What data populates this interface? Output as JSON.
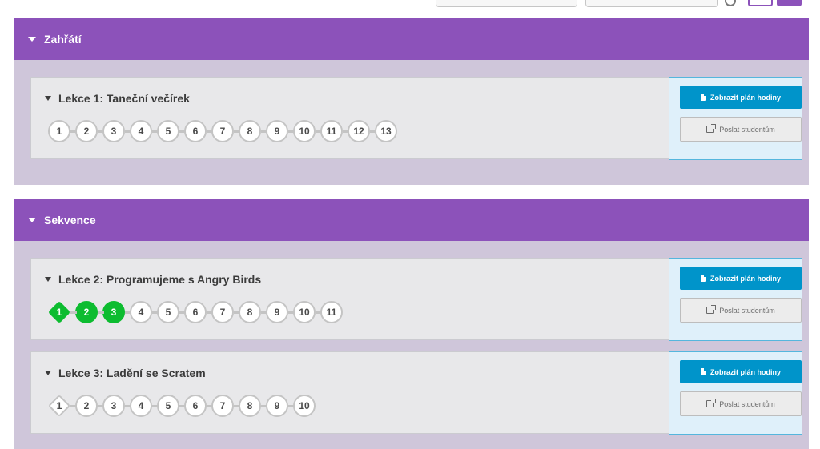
{
  "units": [
    {
      "title": "Zahřátí",
      "lessons": [
        {
          "title": "Lekce 1: Taneční večírek",
          "bubbles": [
            {
              "label": "1",
              "shape": "circle",
              "done": false
            },
            {
              "label": "2",
              "shape": "circle",
              "done": false
            },
            {
              "label": "3",
              "shape": "circle",
              "done": false
            },
            {
              "label": "4",
              "shape": "circle",
              "done": false
            },
            {
              "label": "5",
              "shape": "circle",
              "done": false
            },
            {
              "label": "6",
              "shape": "circle",
              "done": false
            },
            {
              "label": "7",
              "shape": "circle",
              "done": false
            },
            {
              "label": "8",
              "shape": "circle",
              "done": false
            },
            {
              "label": "9",
              "shape": "circle",
              "done": false
            },
            {
              "label": "10",
              "shape": "circle",
              "done": false
            },
            {
              "label": "11",
              "shape": "circle",
              "done": false
            },
            {
              "label": "12",
              "shape": "circle",
              "done": false
            },
            {
              "label": "13",
              "shape": "circle",
              "done": false
            }
          ],
          "plan_label": "Zobrazit plán hodiny",
          "send_label": "Poslat studentům"
        }
      ]
    },
    {
      "title": "Sekvence",
      "lessons": [
        {
          "title": "Lekce 2: Programujeme s Angry Birds",
          "bubbles": [
            {
              "label": "1",
              "shape": "diamond",
              "done": true
            },
            {
              "label": "2",
              "shape": "circle",
              "done": true
            },
            {
              "label": "3",
              "shape": "circle",
              "done": true
            },
            {
              "label": "4",
              "shape": "circle",
              "done": false
            },
            {
              "label": "5",
              "shape": "circle",
              "done": false
            },
            {
              "label": "6",
              "shape": "circle",
              "done": false
            },
            {
              "label": "7",
              "shape": "circle",
              "done": false
            },
            {
              "label": "8",
              "shape": "circle",
              "done": false
            },
            {
              "label": "9",
              "shape": "circle",
              "done": false
            },
            {
              "label": "10",
              "shape": "circle",
              "done": false
            },
            {
              "label": "11",
              "shape": "circle",
              "done": false
            }
          ],
          "plan_label": "Zobrazit plán hodiny",
          "send_label": "Poslat studentům"
        },
        {
          "title": "Lekce 3: Ladění se Scratem",
          "bubbles": [
            {
              "label": "1",
              "shape": "diamond",
              "done": false
            },
            {
              "label": "2",
              "shape": "circle",
              "done": false
            },
            {
              "label": "3",
              "shape": "circle",
              "done": false
            },
            {
              "label": "4",
              "shape": "circle",
              "done": false
            },
            {
              "label": "5",
              "shape": "circle",
              "done": false
            },
            {
              "label": "6",
              "shape": "circle",
              "done": false
            },
            {
              "label": "7",
              "shape": "circle",
              "done": false
            },
            {
              "label": "8",
              "shape": "circle",
              "done": false
            },
            {
              "label": "9",
              "shape": "circle",
              "done": false
            },
            {
              "label": "10",
              "shape": "circle",
              "done": false
            }
          ],
          "plan_label": "Zobrazit plán hodiny",
          "send_label": "Poslat studentům"
        }
      ]
    }
  ],
  "colors": {
    "unit_header": "#8c52ba",
    "unit_body": "#cfc6da",
    "primary_button": "#0094ca",
    "progress_done": "#0dbc30",
    "action_panel_border": "#55b6dd"
  },
  "icons": {
    "unit_toggle": "caret-down-icon",
    "plan_button": "document-icon",
    "send_button": "share-icon"
  }
}
